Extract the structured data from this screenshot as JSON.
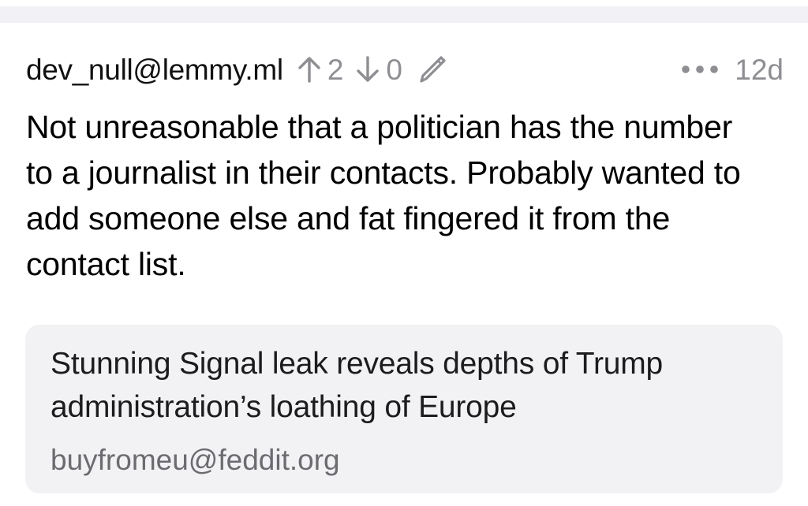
{
  "comment": {
    "author": "dev_null@lemmy.ml",
    "upvotes": "2",
    "downvotes": "0",
    "age": "12d",
    "body": "Not unreasonable that a politician has the number to a journalist in their contacts. Probably wanted to add someone else and fat fingered it from the contact list."
  },
  "link_card": {
    "title": "Stunning Signal leak reveals depths of Trump administration’s loathing of Europe",
    "source": "buyfromeu@feddit.org"
  },
  "icons": {
    "upvote": "arrow-up-icon",
    "downvote": "arrow-down-icon",
    "edit": "pencil-icon",
    "more": "ellipsis-icon"
  },
  "colors": {
    "meta_gray": "#8e8e93",
    "card_background": "#f2f2f4",
    "divider": "#f2f2f6"
  }
}
